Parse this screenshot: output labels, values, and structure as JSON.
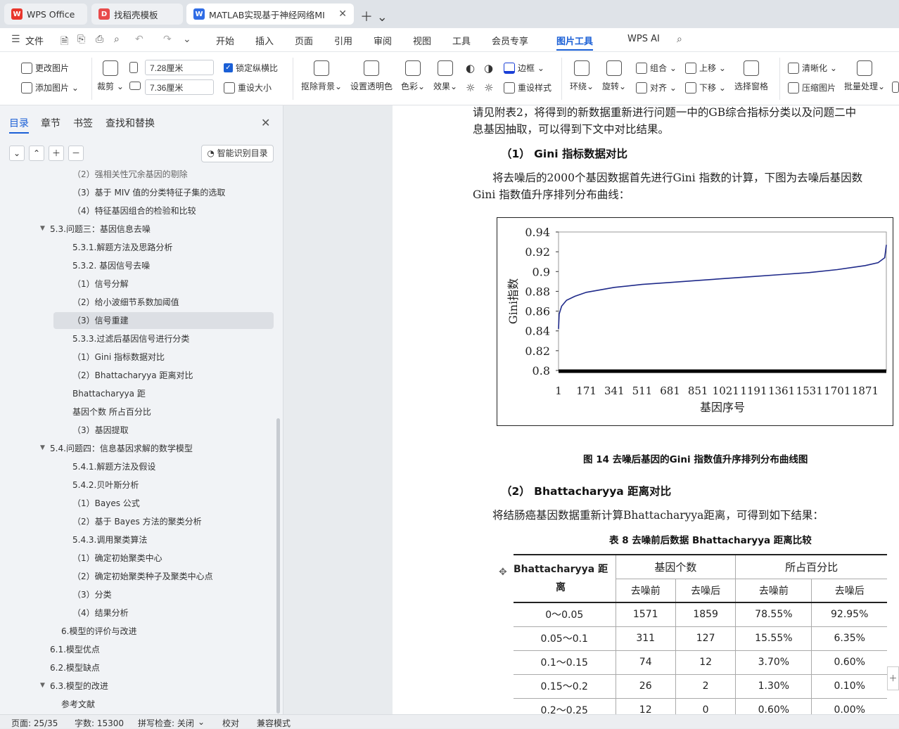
{
  "tabs": [
    {
      "label": "WPS Office"
    },
    {
      "label": "找稻壳模板"
    },
    {
      "label": "MATLAB实现基于神经网络MI"
    }
  ],
  "menu": {
    "file": "文件",
    "items": [
      "开始",
      "插入",
      "页面",
      "引用",
      "审阅",
      "视图",
      "工具",
      "会员专享",
      "图片工具",
      "WPS AI"
    ]
  },
  "ribbon": {
    "change_image": "更改图片",
    "add_image": "添加图片",
    "crop": "裁剪",
    "width": "7.28厘米",
    "height": "7.36厘米",
    "lock_ratio": "锁定纵横比",
    "reset_size": "重设大小",
    "remove_bg": "抠除背景",
    "set_transparent": "设置透明色",
    "color": "色彩",
    "effect": "效果",
    "border": "边框",
    "reset_style": "重设样式",
    "wrap": "环绕",
    "rotate": "旋转",
    "group": "组合",
    "align": "对齐",
    "bring_up": "上移",
    "send_down": "下移",
    "select_pane": "选择窗格",
    "clarify": "清晰化",
    "compress": "压缩图片",
    "batch": "批量处理"
  },
  "sidebar": {
    "tabs": [
      "目录",
      "章节",
      "书签",
      "查找和替换"
    ],
    "smart_toc": "智能识别目录",
    "toc": [
      {
        "label": "（2）强相关性冗余基因的剔除"
      },
      {
        "label": "（3）基于 MIV 值的分类特征子集的选取"
      },
      {
        "label": "（4）特征基因组合的检验和比较"
      },
      {
        "label": "5.3.问题三：基因信息去噪"
      },
      {
        "label": "5.3.1.解题方法及思路分析"
      },
      {
        "label": "5.3.2. 基因信号去噪"
      },
      {
        "label": "（1）信号分解"
      },
      {
        "label": "（2）给小波细节系数加阈值"
      },
      {
        "label": "（3）信号重建"
      },
      {
        "label": "5.3.3.过滤后基因信号进行分类"
      },
      {
        "label": "（1）Gini 指标数据对比"
      },
      {
        "label": "（2）Bhattacharyya 距离对比"
      },
      {
        "label": "Bhattacharyya 距"
      },
      {
        "label": "基因个数 所占百分比"
      },
      {
        "label": "（3）基因提取"
      },
      {
        "label": "5.4.问题四：信息基因求解的数学模型"
      },
      {
        "label": "5.4.1.解题方法及假设"
      },
      {
        "label": "5.4.2.贝叶斯分析"
      },
      {
        "label": "（1）Bayes 公式"
      },
      {
        "label": "（2）基于 Bayes 方法的聚类分析"
      },
      {
        "label": "5.4.3.调用聚类算法"
      },
      {
        "label": "（1）确定初始聚类中心"
      },
      {
        "label": "（2）确定初始聚类种子及聚类中心点"
      },
      {
        "label": "（3）分类"
      },
      {
        "label": "（4）结果分析"
      },
      {
        "label": "6.模型的评价与改进"
      },
      {
        "label": "6.1.模型优点"
      },
      {
        "label": "6.2.模型缺点"
      },
      {
        "label": "6.3.模型的改进"
      },
      {
        "label": "参考文献"
      }
    ]
  },
  "doc": {
    "line1": "请见附表2，将得到的新数据重新进行问题一中的GB综合指标分类以及问题二中",
    "line2": "息基因抽取，可以得到下文中对比结果。",
    "h1": "（1） Gini 指标数据对比",
    "p1a": "将去噪后的2000个基因数据首先进行Gini 指数的计算，下图为去噪后基因数",
    "p1b": "Gini 指数值升序排列分布曲线：",
    "fig_cap": "图 14    去噪后基因的Gini 指数值升序排列分布曲线图",
    "h2": "（2） Bhattacharyya 距离对比",
    "p2": "将结肠癌基因数据重新计算Bhattacharyya距离，可得到如下结果：",
    "tbl_cap": "表 8 去噪前后数据  Bhattacharyya 距离比较",
    "table": {
      "head1": "Bhattacharyya 距",
      "head1b": "离",
      "head2": "基因个数",
      "head3": "所占百分比",
      "sub": [
        "去噪前",
        "去噪后",
        "去噪前",
        "去噪后"
      ],
      "rows": [
        [
          "0～0.05",
          "1571",
          "1859",
          "78.55%",
          "92.95%"
        ],
        [
          "0.05～0.1",
          "311",
          "127",
          "15.55%",
          "6.35%"
        ],
        [
          "0.1～0.15",
          "74",
          "12",
          "3.70%",
          "0.60%"
        ],
        [
          "0.15～0.2",
          "26",
          "2",
          "1.30%",
          "0.10%"
        ],
        [
          "0.2～0.25",
          "12",
          "0",
          "0.60%",
          "0.00%"
        ]
      ]
    }
  },
  "chart_data": {
    "type": "line",
    "xlabel": "基因序号",
    "ylabel": "Gini指数",
    "ylim": [
      0.8,
      0.94
    ],
    "yticks": [
      "0.94",
      "0.92",
      "0.9",
      "0.88",
      "0.86",
      "0.84",
      "0.82",
      "0.8"
    ],
    "xticks": [
      "1",
      "171",
      "341",
      "511",
      "681",
      "851",
      "1021",
      "1191",
      "1361",
      "1531",
      "1701",
      "1871"
    ],
    "x": [
      1,
      5,
      20,
      50,
      100,
      171,
      341,
      511,
      681,
      851,
      1021,
      1191,
      1361,
      1531,
      1701,
      1871,
      1950,
      1990,
      2000
    ],
    "values": [
      0.842,
      0.857,
      0.865,
      0.871,
      0.875,
      0.879,
      0.884,
      0.887,
      0.889,
      0.891,
      0.893,
      0.895,
      0.897,
      0.899,
      0.902,
      0.906,
      0.909,
      0.914,
      0.927
    ]
  },
  "status": {
    "page": "页面: 25/35",
    "words": "字数: 15300",
    "spell": "拼写检查: 关闭",
    "proof": "校对",
    "compat": "兼容模式"
  }
}
